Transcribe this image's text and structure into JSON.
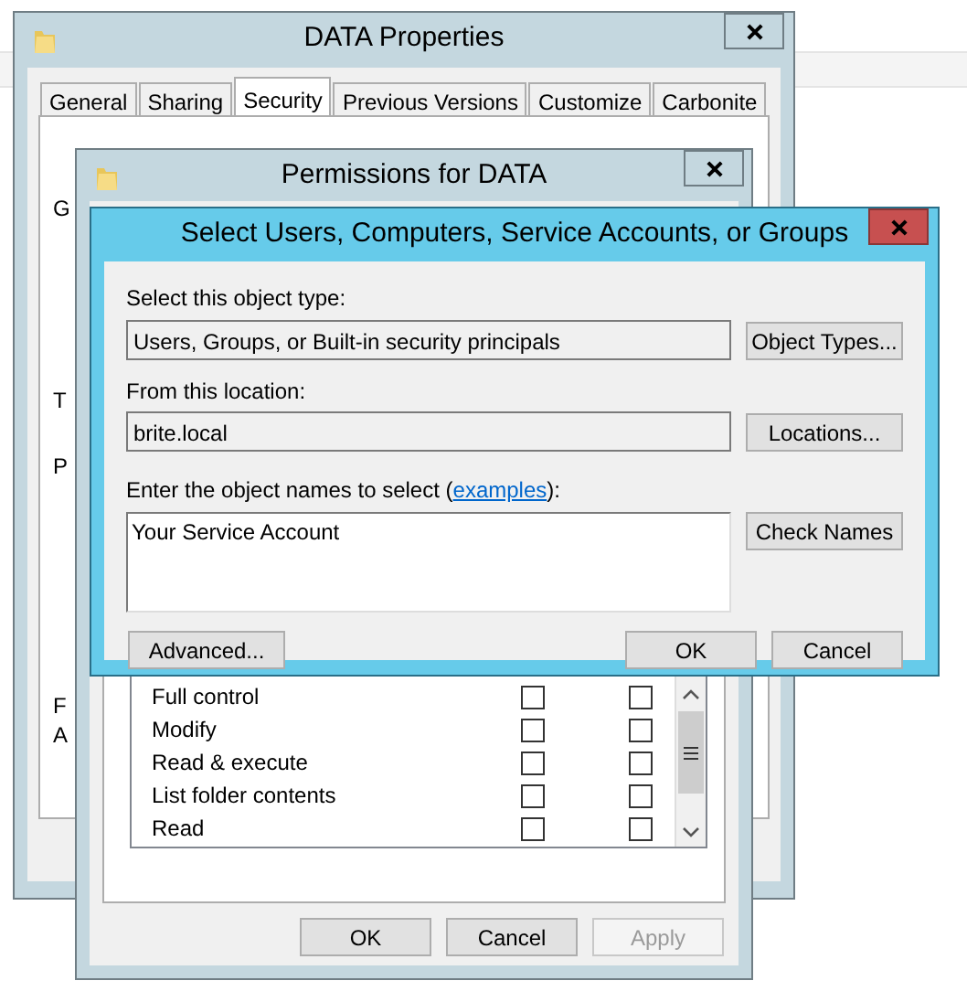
{
  "properties_window": {
    "title": "DATA Properties",
    "tabs": [
      {
        "label": "General",
        "selected": false
      },
      {
        "label": "Sharing",
        "selected": false
      },
      {
        "label": "Security",
        "selected": true
      },
      {
        "label": "Previous Versions",
        "selected": false
      },
      {
        "label": "Customize",
        "selected": false
      },
      {
        "label": "Carbonite",
        "selected": false
      }
    ],
    "cut_labels": [
      "G",
      "T",
      "P",
      "F",
      "A"
    ]
  },
  "permissions_window": {
    "title": "Permissions for DATA",
    "permissions": [
      {
        "name": "Full control",
        "allow": false,
        "deny": false
      },
      {
        "name": "Modify",
        "allow": false,
        "deny": false
      },
      {
        "name": "Read & execute",
        "allow": false,
        "deny": false
      },
      {
        "name": "List folder contents",
        "allow": false,
        "deny": false
      },
      {
        "name": "Read",
        "allow": false,
        "deny": false
      }
    ],
    "buttons": [
      {
        "label": "OK",
        "disabled": false
      },
      {
        "label": "Cancel",
        "disabled": false
      },
      {
        "label": "Apply",
        "disabled": true
      }
    ]
  },
  "select_dialog": {
    "title": "Select Users, Computers, Service Accounts, or Groups",
    "object_type_label": "Select this object type:",
    "object_type": "Users, Groups, or Built-in security principals",
    "object_types_button": "Object Types...",
    "location_label": "From this location:",
    "location": "brite.local",
    "locations_button": "Locations...",
    "names_label_before": "Enter the object names to select (",
    "examples_link": "examples",
    "names_label_after": "):",
    "names_value": "Your Service Account",
    "check_names_button": "Check Names",
    "advanced_button": "Advanced...",
    "ok_button": "OK",
    "cancel_button": "Cancel"
  }
}
